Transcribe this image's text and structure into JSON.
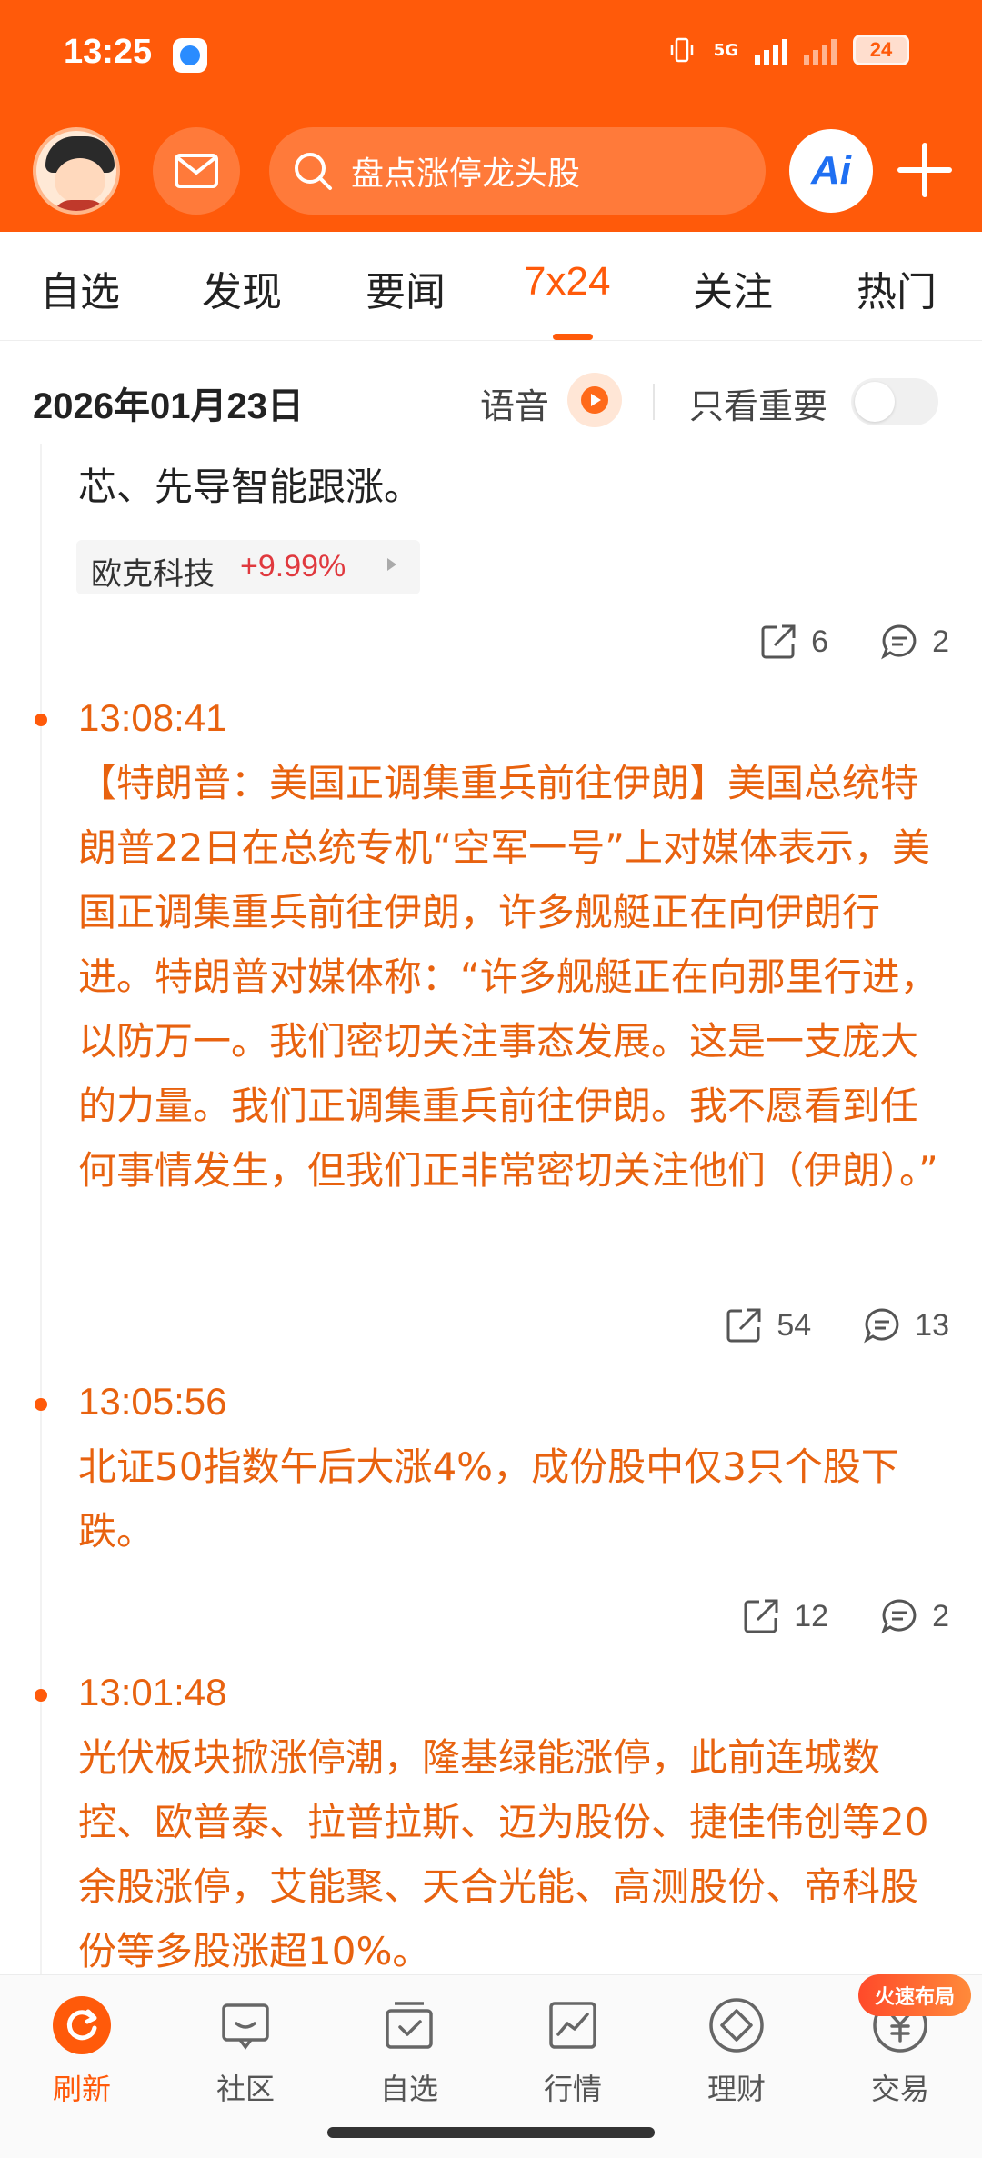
{
  "status_bar": {
    "time": "13:25",
    "network": "5G",
    "battery": "24"
  },
  "colors": {
    "brand": "#ff5a0a",
    "news_text": "#e8620f",
    "up": "#e0393e"
  },
  "header": {
    "search_placeholder": "盘点涨停龙头股",
    "ai_label": "Ai",
    "icons": [
      "avatar",
      "mail-icon",
      "search-icon",
      "plus-icon"
    ]
  },
  "tabs": [
    {
      "label": "自选",
      "active": false
    },
    {
      "label": "发现",
      "active": false
    },
    {
      "label": "要闻",
      "active": false
    },
    {
      "label": "7x24",
      "active": true
    },
    {
      "label": "关注",
      "active": false
    },
    {
      "label": "热门",
      "active": false
    }
  ],
  "date_bar": {
    "date": "2026年01月23日",
    "voice_label": "语音",
    "important_label": "只看重要",
    "important_on": false
  },
  "feed": {
    "partial": {
      "text": "芯、先导智能跟涨。",
      "stock": {
        "name": "欧克科技",
        "change": "+9.99%"
      },
      "shares": "6",
      "comments": "2"
    },
    "entries": [
      {
        "time": "13:08:41",
        "text": "【特朗普：美国正调集重兵前往伊朗】美国总统特朗普22日在总统专机“空军一号”上对媒体表示，美国正调集重兵前往伊朗，许多舰艇正在向伊朗行进。特朗普对媒体称：“许多舰艇正在向那里行进，以防万一。我们密切关注事态发展。这是一支庞大的力量。我们正调集重兵前往伊朗。我不愿看到任何事情发生，但我们正非常密切关注他们（伊朗）。”",
        "shares": "54",
        "comments": "13"
      },
      {
        "time": "13:05:56",
        "text": "北证50指数午后大涨4%，成份股中仅3只个股下跌。",
        "shares": "12",
        "comments": "2"
      },
      {
        "time": "13:01:48",
        "text": "光伏板块掀涨停潮，隆基绿能涨停，此前连城数控、欧普泰、拉普拉斯、迈为股份、捷佳伟创等20余股涨停，艾能聚、天合光能、高测股份、帝科股份等多股涨超10%。"
      }
    ]
  },
  "bottom_nav": [
    {
      "label": "刷新",
      "icon": "refresh-icon",
      "active": true
    },
    {
      "label": "社区",
      "icon": "community-icon",
      "active": false
    },
    {
      "label": "自选",
      "icon": "watchlist-icon",
      "active": false
    },
    {
      "label": "行情",
      "icon": "market-icon",
      "active": false
    },
    {
      "label": "理财",
      "icon": "wealth-icon",
      "active": false
    },
    {
      "label": "交易",
      "icon": "trade-icon",
      "active": false
    }
  ],
  "promo_badge": "火速布局"
}
